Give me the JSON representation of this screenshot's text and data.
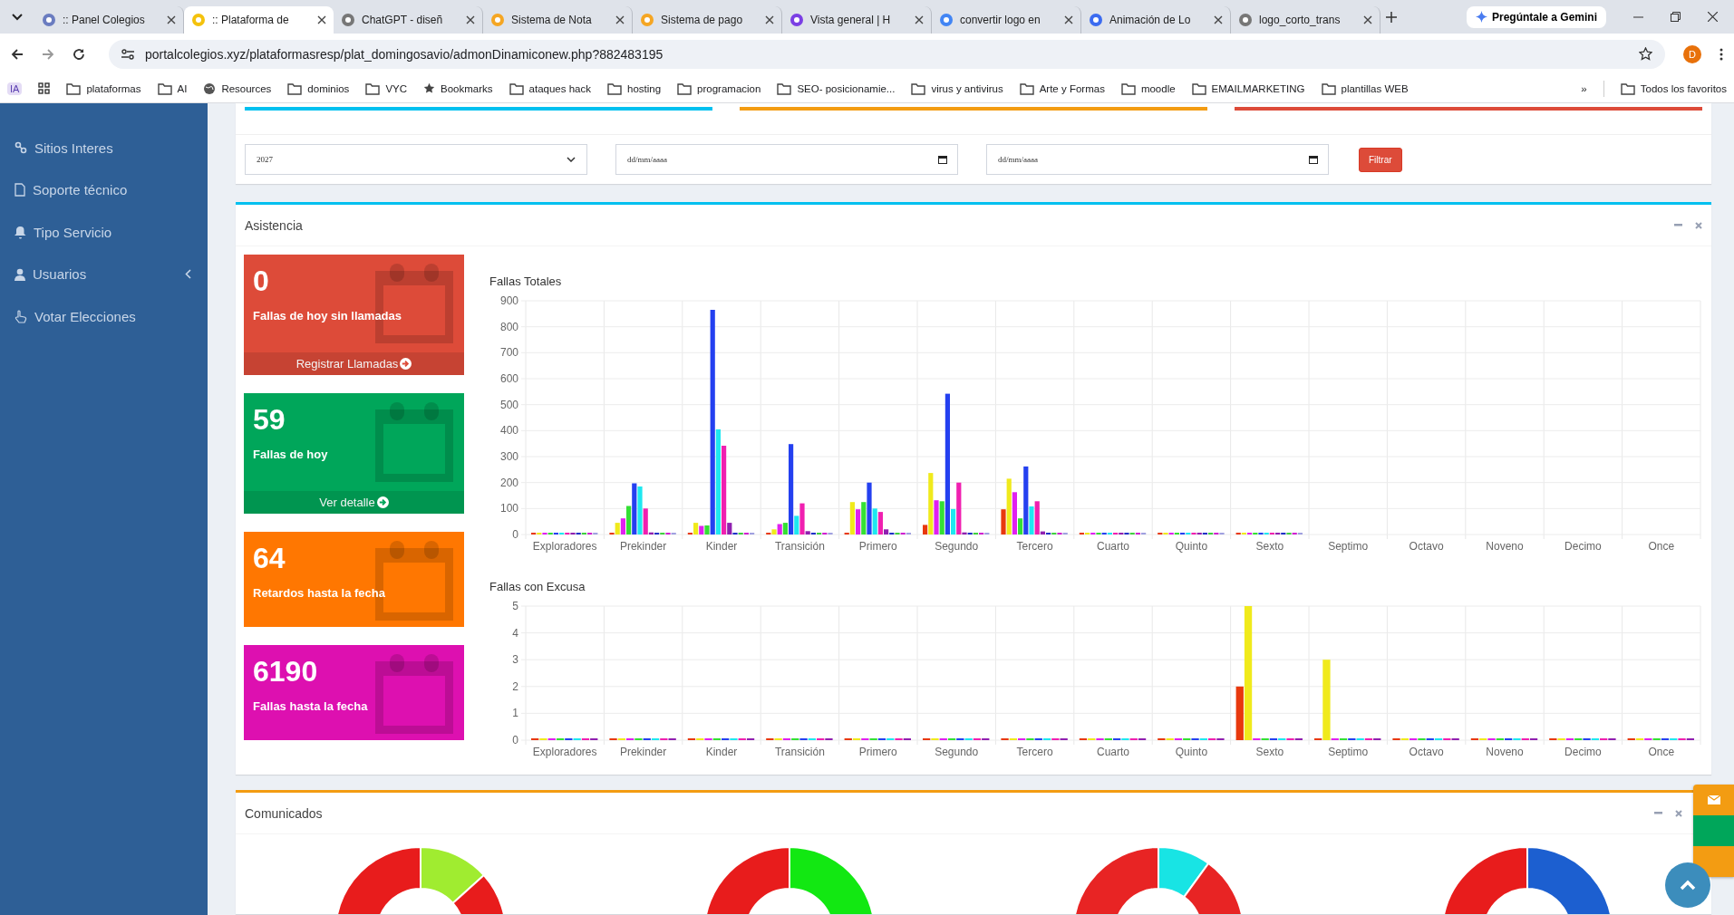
{
  "browser": {
    "tabs": [
      {
        "title": ":: Panel Colegios",
        "selected": false
      },
      {
        "title": ":: Plataforma de",
        "selected": true
      },
      {
        "title": "ChatGPT - diseñ",
        "selected": false
      },
      {
        "title": "Sistema de Nota",
        "selected": false
      },
      {
        "title": "Sistema de pago",
        "selected": false
      },
      {
        "title": "Vista general | H",
        "selected": false
      },
      {
        "title": "convertir logo en",
        "selected": false
      },
      {
        "title": "Animación de Lo",
        "selected": false
      },
      {
        "title": "logo_corto_trans",
        "selected": false
      }
    ],
    "gemini_button": "Pregúntale a Gemini",
    "url": "portalcolegios.xyz/plataformasresp/plat_domingosavio/admonDinamiconew.php?882483195",
    "profile": "D",
    "bookmarks_badge": "IA",
    "bookmarks": [
      "plataformas",
      "AI",
      "Resources",
      "dominios",
      "VYC",
      "Bookmarks",
      "ataques hack",
      "hosting",
      "programacion",
      "SEO- posicionamie...",
      "virus y antivirus",
      "Arte y Formas",
      "moodle",
      "EMAILMARKETING",
      "plantillas WEB"
    ],
    "bookmarks_more": "»",
    "all_bookmarks": "Todos los favoritos"
  },
  "sidebar": {
    "items": [
      {
        "label": "Sitios Interes",
        "has_submenu": false
      },
      {
        "label": "Soporte técnico",
        "has_submenu": false
      },
      {
        "label": "Tipo Servicio",
        "has_submenu": false
      },
      {
        "label": "Usuarios",
        "has_submenu": true
      },
      {
        "label": "Votar Elecciones",
        "has_submenu": false
      }
    ]
  },
  "summary_bars": [
    {
      "color": "#00c0ef",
      "level": 0.3
    },
    {
      "color": "#f39c12",
      "level": 0.3
    },
    {
      "color": "#dd4b39",
      "level": 0.3
    }
  ],
  "filter": {
    "year": "2027",
    "date_from": {
      "placeholder": "dd/mm/aaaa"
    },
    "date_to": {
      "placeholder": "dd/mm/aaaa"
    },
    "button": "Filtrar"
  },
  "asistencia": {
    "title": "Asistencia",
    "cards": [
      {
        "value": "0",
        "label": "Fallas de hoy sin llamadas",
        "link": "Registrar Llamadas",
        "color": "#dd4b39"
      },
      {
        "value": "59",
        "label": "Fallas de hoy",
        "link": "Ver detalle",
        "color": "#00a65a"
      },
      {
        "value": "64",
        "label": "Retardos hasta la fecha",
        "color": "#ff7701"
      },
      {
        "value": "6190",
        "label": "Fallas hasta la fecha",
        "color": "#dd10b0"
      }
    ],
    "charts": [
      {
        "chart_data": {
          "type": "bar",
          "title": "Fallas Totales",
          "grid": true,
          "categories": [
            "Exploradores",
            "Prekinder",
            "Kinder",
            "Transición",
            "Primero",
            "Segundo",
            "Tercero",
            "Cuarto",
            "Quinto",
            "Sexto",
            "Septimo",
            "Octavo",
            "Noveno",
            "Decimo",
            "Once"
          ],
          "ylim": [
            0,
            900
          ],
          "yticks": [
            0,
            100,
            200,
            300,
            400,
            500,
            600,
            700,
            800,
            900
          ],
          "series": [
            {
              "color": "#e8380d",
              "values": [
                0,
                0,
                0,
                0,
                0,
                37,
                97,
                0,
                0,
                0,
                null,
                null,
                null,
                null,
                null
              ]
            },
            {
              "color": "#f0ea1c",
              "values": [
                0,
                45,
                45,
                20,
                125,
                237,
                215,
                0,
                0,
                0,
                null,
                null,
                null,
                null,
                null
              ]
            },
            {
              "color": "#e020f0",
              "values": [
                0,
                62,
                33,
                40,
                97,
                132,
                163,
                0,
                2,
                0,
                null,
                null,
                null,
                null,
                null
              ]
            },
            {
              "color": "#34e034",
              "values": [
                0,
                110,
                35,
                45,
                125,
                128,
                62,
                0,
                0,
                0,
                null,
                null,
                null,
                null,
                null
              ]
            },
            {
              "color": "#2440f0",
              "values": [
                0,
                197,
                865,
                348,
                200,
                542,
                262,
                0,
                3,
                0,
                null,
                null,
                null,
                null,
                null
              ]
            },
            {
              "color": "#1ee8f0",
              "values": [
                0,
                185,
                405,
                72,
                100,
                98,
                108,
                0,
                2,
                0,
                null,
                null,
                null,
                null,
                null
              ]
            },
            {
              "color": "#f020b0",
              "values": [
                0,
                100,
                342,
                120,
                87,
                200,
                128,
                0,
                0,
                0,
                null,
                null,
                null,
                null,
                null
              ]
            },
            {
              "color": "#9020b0",
              "values": [
                0,
                8,
                45,
                13,
                20,
                8,
                12,
                0,
                0,
                0,
                null,
                null,
                null,
                null,
                null
              ]
            },
            {
              "color": "#2030c8",
              "values": [
                0,
                0,
                0,
                0,
                0,
                0,
                0,
                0,
                0,
                0,
                null,
                null,
                null,
                null,
                null
              ]
            },
            {
              "color": "#40d040",
              "values": [
                0,
                0,
                0,
                0,
                0,
                0,
                0,
                0,
                0,
                0,
                null,
                null,
                null,
                null,
                null
              ]
            },
            {
              "color": "#d020d0",
              "values": [
                0,
                0,
                0,
                0,
                0,
                0,
                0,
                0,
                0,
                0,
                null,
                null,
                null,
                null,
                null
              ]
            },
            {
              "color": "#a0a0e0",
              "values": [
                0,
                0,
                0,
                0,
                0,
                0,
                0,
                0,
                0,
                0,
                null,
                null,
                null,
                null,
                null
              ]
            }
          ]
        }
      },
      {
        "chart_data": {
          "type": "bar",
          "title": "Fallas con Excusa",
          "grid": true,
          "categories": [
            "Exploradores",
            "Prekinder",
            "Kinder",
            "Transición",
            "Primero",
            "Segundo",
            "Tercero",
            "Cuarto",
            "Quinto",
            "Sexto",
            "Septimo",
            "Octavo",
            "Noveno",
            "Decimo",
            "Once"
          ],
          "ylim": [
            0,
            5
          ],
          "yticks": [
            0,
            1,
            2,
            3,
            4,
            5
          ],
          "series": [
            {
              "color": "#e8380d",
              "values": [
                0,
                0,
                0,
                0,
                0,
                0,
                0,
                0,
                0,
                2,
                0,
                0,
                0,
                0,
                0
              ]
            },
            {
              "color": "#f0ea1c",
              "values": [
                0,
                0,
                0,
                0,
                0,
                0,
                0,
                0,
                0,
                5,
                3,
                0,
                0,
                0,
                0
              ]
            },
            {
              "color": "#e020f0",
              "values": [
                0,
                0,
                0,
                0,
                0,
                0,
                0,
                0,
                0,
                0,
                0,
                0,
                0,
                0,
                0
              ]
            },
            {
              "color": "#34e034",
              "values": [
                0,
                0,
                0,
                0,
                0,
                0,
                0,
                0,
                0,
                0,
                0,
                0,
                0,
                0,
                0
              ]
            },
            {
              "color": "#2440f0",
              "values": [
                0,
                0,
                0,
                0,
                0,
                0,
                0,
                0,
                0,
                0,
                0,
                0,
                0,
                0,
                0
              ]
            },
            {
              "color": "#1ee8f0",
              "values": [
                0,
                0,
                0,
                0,
                0,
                0,
                0,
                0,
                0,
                0,
                0,
                0,
                0,
                0,
                0
              ]
            },
            {
              "color": "#f020b0",
              "values": [
                0,
                0,
                0,
                0,
                0,
                0,
                0,
                0,
                0,
                0,
                0,
                0,
                0,
                0,
                0
              ]
            },
            {
              "color": "#9020b0",
              "values": [
                0,
                0,
                0,
                0,
                0,
                0,
                0,
                0,
                0,
                0,
                0,
                0,
                0,
                0,
                0
              ]
            }
          ]
        }
      }
    ]
  },
  "comunicados": {
    "title": "Comunicados"
  }
}
